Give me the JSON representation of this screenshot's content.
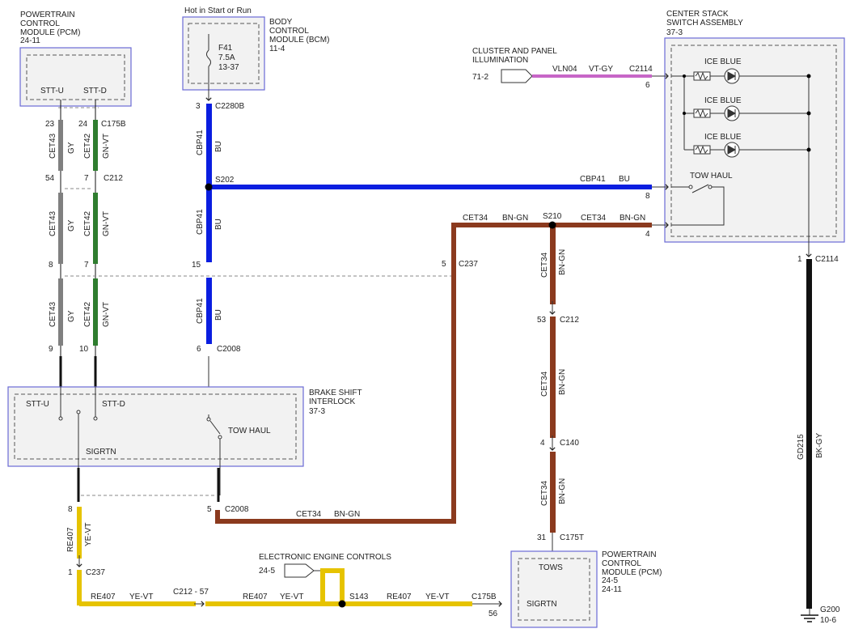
{
  "modules": {
    "pcm_top": {
      "name": "POWERTRAIN\nCONTROL\nMODULE (PCM)",
      "ref": "24-11",
      "pin_u": "STT-U",
      "pin_d": "STT-D"
    },
    "bcm": {
      "note": "Hot in Start or Run",
      "name": "BODY\nCONTROL\nMODULE (BCM)",
      "ref": "11-4",
      "fuse": "F41",
      "fuse_amp": "7.5A",
      "fuse_ref": "13-37"
    },
    "csa": {
      "name": "CENTER STACK\nSWITCH ASSEMBLY",
      "ref": "37-3",
      "lamp1": "ICE BLUE",
      "lamp2": "ICE BLUE",
      "lamp3": "ICE BLUE",
      "switch": "TOW HAUL"
    },
    "cluster": {
      "name": "CLUSTER AND PANEL\nILLUMINATION",
      "ref": "71-2"
    },
    "bsi": {
      "name": "BRAKE SHIFT\nINTERLOCK",
      "ref": "37-3",
      "pin_u": "STT-U",
      "pin_d": "STT-D",
      "sigrtn": "SIGRTN",
      "tow": "TOW HAUL"
    },
    "eec": {
      "name": "ELECTRONIC ENGINE CONTROLS",
      "ref": "24-5"
    },
    "pcm_bot": {
      "name": "POWERTRAIN\nCONTROL\nMODULE (PCM)",
      "ref": "24-5\n24-11",
      "tows": "TOWS",
      "sigrtn": "SIGRTN"
    }
  },
  "wires": {
    "cet43": "CET43",
    "gy": "GY",
    "cet42": "CET42",
    "gnvt": "GN-VT",
    "cbp41": "CBP41",
    "bu": "BU",
    "vln04": "VLN04",
    "vtgy": "VT-GY",
    "cet34": "CET34",
    "bngn": "BN-GN",
    "re407": "RE407",
    "yevt": "YE-VT",
    "gd215": "GD215",
    "bkgy": "BK-GY"
  },
  "connectors": {
    "c175b": "C175B",
    "c212": "C212",
    "c2280b": "C2280B",
    "s202": "S202",
    "c2008": "C2008",
    "c2114": "C2114",
    "s210": "S210",
    "c237": "C237",
    "c140": "C140",
    "c175t": "C175T",
    "s143": "S143",
    "c212_57": "C212 -  57",
    "g200": "G200",
    "g200_ref": "10-6"
  },
  "pins": {
    "p23": "23",
    "p24": "24",
    "p54": "54",
    "p7a": "7",
    "p8": "8",
    "p7b": "7",
    "p9": "9",
    "p10": "10",
    "p3": "3",
    "p15": "15",
    "p6": "6",
    "csa6": "6",
    "csa8": "8",
    "csa4": "4",
    "p5a": "5",
    "p53": "53",
    "p4": "4",
    "p31": "31",
    "p8b": "8",
    "p5b": "5",
    "p1": "1",
    "p1b": "1",
    "p56": "56"
  },
  "colors": {
    "gray_wire": "#808080",
    "green_wire": "#2f7d2f",
    "blue_wire": "#0a1ee0",
    "brown_wire": "#8b3a1e",
    "yellow_wire": "#e6c300",
    "pink_wire": "#c766c7",
    "black_wire": "#111111",
    "module_border": "#6b6bd6"
  }
}
